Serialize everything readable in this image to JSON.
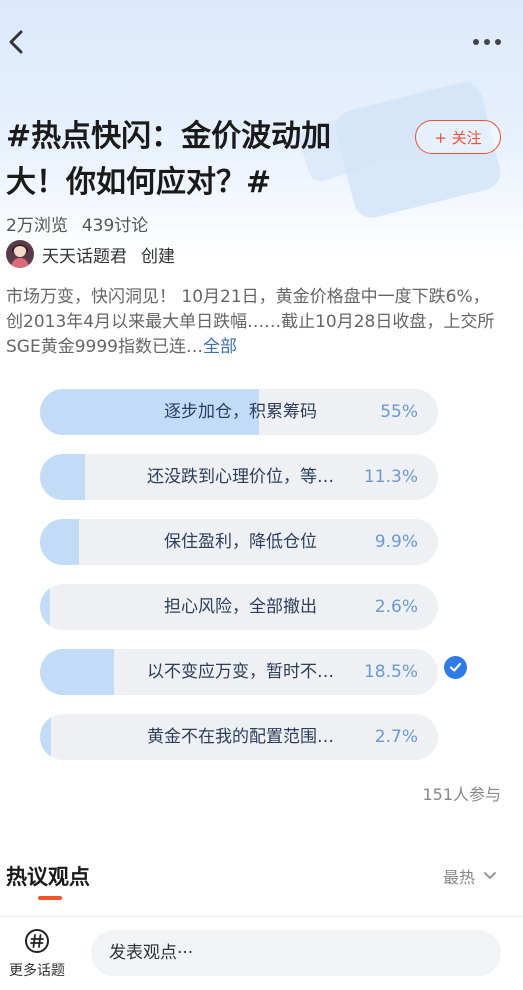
{
  "header": {
    "back_icon": "chevron-left-icon",
    "more_icon": "more-dots-icon"
  },
  "topic": {
    "title": "#热点快闪：金价波动加大！你如何应对？#",
    "follow_label": "+ 关注",
    "views": "2万浏览",
    "discussions": "439讨论",
    "creator_name": "天天话题君",
    "creator_role": "创建",
    "description": "市场万变，快闪洞见！ 10月21日，黄金价格盘中一度下跌6%，创2013年4月以来最大单日跌幅……截止10月28日收盘，上交所SGE黄金9999指数已连…",
    "description_more": "全部"
  },
  "poll": {
    "accent_color": "#2f7be5",
    "fill_color": "#c2dcf7",
    "options": [
      {
        "label": "逐步加仓，积累筹码",
        "percent": "55%",
        "value": 0.55,
        "selected": false
      },
      {
        "label": "还没跌到心理价位，等…",
        "percent": "11.3%",
        "value": 0.113,
        "selected": false
      },
      {
        "label": "保住盈利，降低仓位",
        "percent": "9.9%",
        "value": 0.099,
        "selected": false
      },
      {
        "label": "担心风险，全部撤出",
        "percent": "2.6%",
        "value": 0.026,
        "selected": false
      },
      {
        "label": "以不变应万变，暂时不…",
        "percent": "18.5%",
        "value": 0.185,
        "selected": true
      },
      {
        "label": "黄金不在我的配置范围…",
        "percent": "2.7%",
        "value": 0.027,
        "selected": false
      }
    ],
    "participants": "151人参与"
  },
  "hot": {
    "title": "热议观点",
    "sort_label": "最热",
    "accent_color": "#f0552c"
  },
  "bottom": {
    "more_label": "更多话题",
    "more_icon": "hashtag-icon",
    "comment_placeholder": "发表观点···"
  }
}
